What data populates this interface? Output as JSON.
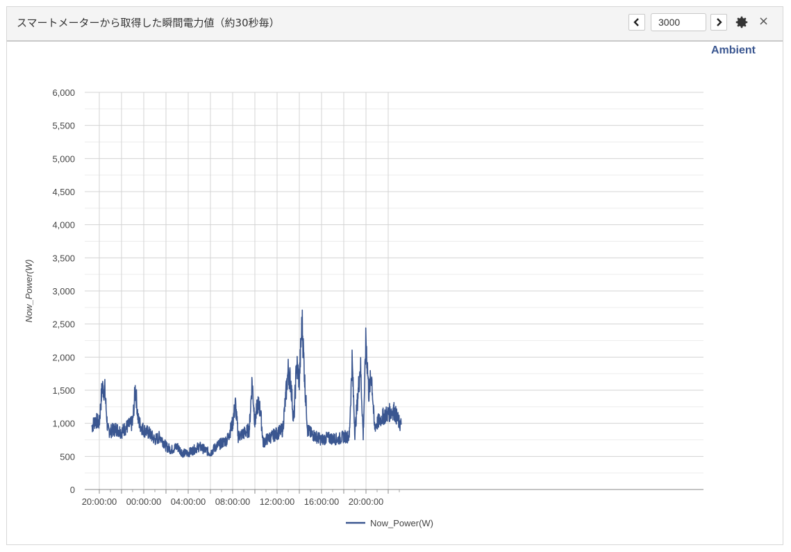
{
  "header": {
    "title": "スマートメーターから取得した瞬間電力値（約30秒毎）",
    "count_value": "3000"
  },
  "brand": "Ambient",
  "icons": {
    "prev": "chevron-left-icon",
    "next": "chevron-right-icon",
    "settings": "gear-icon",
    "close": "close-icon"
  },
  "colors": {
    "series": "#3a5690",
    "grid": "#d0d0d0",
    "brand": "#3a5690"
  },
  "chart_data": {
    "type": "line",
    "ylabel": "Now_Power(W)",
    "xlabel": "",
    "ylim": [
      0,
      6000
    ],
    "yticks": [
      "0",
      "500",
      "1,000",
      "1,500",
      "2,000",
      "2,500",
      "3,000",
      "3,500",
      "4,000",
      "4,500",
      "5,000",
      "5,500",
      "6,000"
    ],
    "xticks": [
      "20:00:00",
      "00:00:00",
      "04:00:00",
      "08:00:00",
      "12:00:00",
      "16:00:00",
      "20:00:00"
    ],
    "grid": true,
    "legend": "bottom",
    "x_range": [
      "19:20",
      "23:10 (next day)"
    ],
    "series": [
      {
        "name": "Now_Power(W)",
        "x": [
          "19:20",
          "19:40",
          "20:00",
          "20:15",
          "20:30",
          "20:45",
          "21:00",
          "21:30",
          "22:00",
          "22:30",
          "23:00",
          "23:15",
          "23:30",
          "23:45",
          "00:00",
          "00:30",
          "01:00",
          "01:30",
          "02:00",
          "02:30",
          "03:00",
          "03:30",
          "04:00",
          "04:30",
          "05:00",
          "05:30",
          "06:00",
          "06:30",
          "07:00",
          "07:30",
          "08:00",
          "08:15",
          "08:30",
          "09:00",
          "09:30",
          "09:45",
          "10:00",
          "10:15",
          "10:30",
          "10:45",
          "11:00",
          "11:30",
          "12:00",
          "12:30",
          "13:00",
          "13:15",
          "13:30",
          "13:45",
          "14:00",
          "14:15",
          "14:30",
          "14:45",
          "15:00",
          "15:30",
          "16:00",
          "16:30",
          "17:00",
          "17:30",
          "18:00",
          "18:30",
          "18:45",
          "19:00",
          "19:30",
          "19:45",
          "20:00",
          "20:15",
          "20:30",
          "20:45",
          "21:00",
          "21:30",
          "22:00",
          "22:30",
          "23:00",
          "23:10"
        ],
        "values": [
          950,
          1050,
          1000,
          1550,
          1500,
          900,
          880,
          920,
          870,
          950,
          1000,
          1550,
          1050,
          950,
          900,
          850,
          750,
          800,
          650,
          600,
          650,
          550,
          550,
          600,
          650,
          600,
          550,
          650,
          700,
          750,
          1000,
          1300,
          800,
          850,
          900,
          1650,
          1000,
          1300,
          1200,
          700,
          750,
          800,
          850,
          900,
          1800,
          1600,
          1000,
          1900,
          1650,
          2550,
          1600,
          900,
          850,
          800,
          750,
          780,
          770,
          760,
          800,
          800,
          1950,
          850,
          1900,
          800,
          2300,
          1450,
          1750,
          950,
          1000,
          1100,
          1150,
          1200,
          1000,
          980
        ]
      }
    ]
  }
}
